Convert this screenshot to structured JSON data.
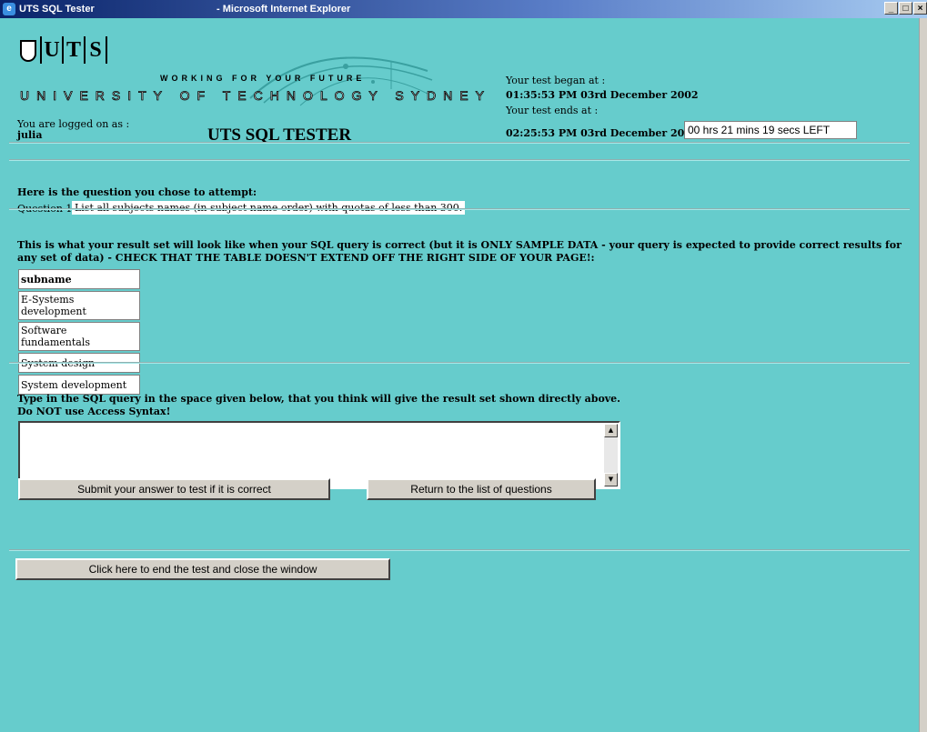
{
  "window": {
    "app_title": "UTS SQL Tester",
    "browser_title": "- Microsoft Internet Explorer",
    "controls": [
      "_",
      "□",
      "×"
    ]
  },
  "header": {
    "logo_letters": [
      "U",
      "T",
      "S"
    ],
    "working_text": "WORKING FOR YOUR FUTURE",
    "university_text": "UNIVERSITY OF TECHNOLOGY SYDNEY",
    "logged_on_label": "You are logged on as :",
    "username": "julia",
    "app_title": "UTS SQL TESTER",
    "test_began_label": "Your test began at :",
    "test_began_time": "01:35:53 PM 03rd December 2002",
    "test_ends_label": "Your test ends at :",
    "test_ends_time": "02:25:53 PM 03rd December 2002",
    "time_left": "00 hrs 21 mins 19 secs LEFT"
  },
  "question": {
    "heading": "Here is the question you chose to attempt:",
    "label": "Question 1.",
    "text": "List all subjects names (in subject name order) with quotas of less than 300."
  },
  "result": {
    "heading": "This is what your result set will look like when your SQL query is correct (but it is ONLY SAMPLE DATA - your query is expected to provide correct results for any set of data) - CHECK THAT THE TABLE DOESN'T EXTEND OFF THE RIGHT SIDE OF YOUR PAGE!:",
    "column": "subname",
    "rows": [
      "E-Systems development",
      "Software fundamentals",
      "System design",
      "System development"
    ]
  },
  "sql": {
    "heading_line1": "Type in the SQL query in the space given below, that you think will give the result set shown directly above.",
    "heading_line2": "Do NOT use Access Syntax!",
    "value": ""
  },
  "buttons": {
    "submit": "Submit your answer to test if it is correct",
    "return": "Return to the list of questions",
    "end": "Click here to end the test and close the window"
  }
}
